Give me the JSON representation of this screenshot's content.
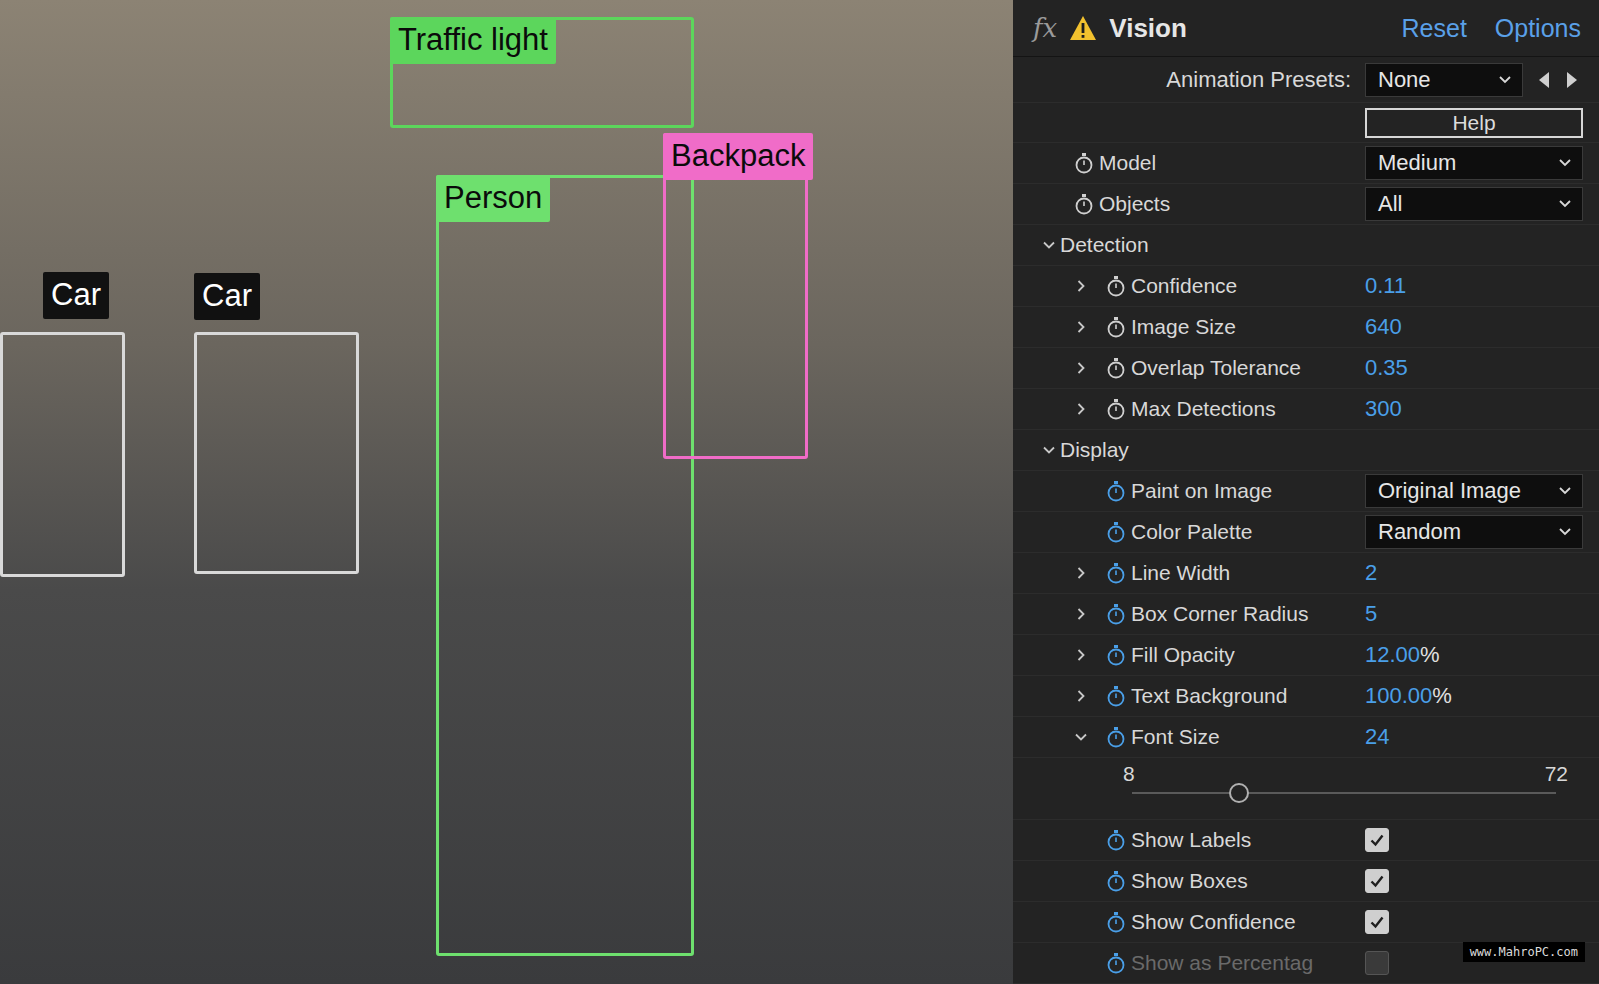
{
  "detections": [
    {
      "label": "Traffic light",
      "color": "#5cd65c",
      "label_color": "#5cd65c"
    },
    {
      "label": "Person",
      "color": "#6ee06e",
      "label_color": "#6ee06e"
    },
    {
      "label": "Backpack",
      "color": "#f06cc8",
      "label_color": "#f06cc8"
    },
    {
      "label": "Car",
      "color": "#d9d9d9",
      "label_color": "#111111"
    },
    {
      "label": "Car",
      "color": "#d9d9d9",
      "label_color": "#111111"
    }
  ],
  "effect": {
    "fx": "fx",
    "title": "Vision",
    "warning": true,
    "reset": "Reset",
    "options": "Options"
  },
  "animation_presets": {
    "label": "Animation Presets:",
    "value": "None"
  },
  "help": "Help",
  "params": [
    {
      "kind": "dropdown",
      "label": "Model",
      "value": "Medium"
    },
    {
      "kind": "dropdown",
      "label": "Objects",
      "value": "All"
    },
    {
      "kind": "group",
      "label": "Detection",
      "expanded": true,
      "color": "#d0d0d0",
      "children": [
        {
          "kind": "number",
          "label": "Confidence",
          "value": "0.11",
          "expanded": false
        },
        {
          "kind": "number",
          "label": "Image Size",
          "value": "640",
          "expanded": false
        },
        {
          "kind": "number",
          "label": "Overlap Tolerance",
          "value": "0.35",
          "expanded": false
        },
        {
          "kind": "number",
          "label": "Max Detections",
          "value": "300",
          "expanded": false
        }
      ]
    },
    {
      "kind": "group",
      "label": "Display",
      "expanded": true,
      "color": "#4a9fe8",
      "children": [
        {
          "kind": "dropdown",
          "label": "Paint on Image",
          "value": "Original Image"
        },
        {
          "kind": "dropdown",
          "label": "Color Palette",
          "value": "Random"
        },
        {
          "kind": "number",
          "label": "Line Width",
          "value": "2",
          "expanded": false
        },
        {
          "kind": "number",
          "label": "Box Corner Radius",
          "value": "5",
          "expanded": false
        },
        {
          "kind": "number",
          "label": "Fill Opacity",
          "value": "12.00",
          "unit": "%",
          "expanded": false
        },
        {
          "kind": "number",
          "label": "Text Background",
          "value": "100.00",
          "unit": "%",
          "expanded": false
        },
        {
          "kind": "number",
          "label": "Font Size",
          "value": "24",
          "expanded": true,
          "slider": {
            "min": "8",
            "max": "72",
            "level": 0.25
          }
        },
        {
          "kind": "checkbox",
          "label": "Show Labels",
          "checked": true,
          "disabled": false
        },
        {
          "kind": "checkbox",
          "label": "Show Boxes",
          "checked": true,
          "disabled": false
        },
        {
          "kind": "checkbox",
          "label": "Show Confidence",
          "checked": true,
          "disabled": false
        },
        {
          "kind": "checkbox",
          "label": "Show as Percentag",
          "checked": false,
          "disabled": true
        }
      ]
    }
  ],
  "watermark": "www.MahroPC.com"
}
